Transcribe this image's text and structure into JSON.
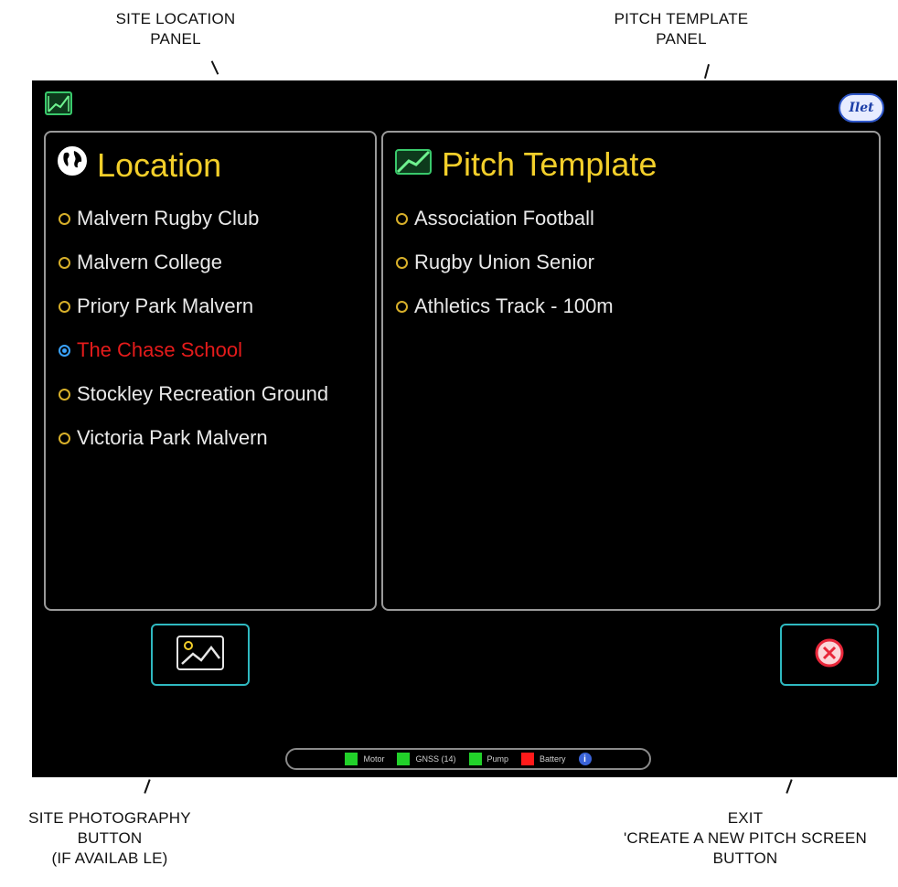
{
  "callouts": {
    "site_location": [
      "SITE LOCATION",
      "PANEL"
    ],
    "pitch_template": [
      "PITCH TEMPLATE",
      "PANEL"
    ],
    "site_photography": [
      "SITE PHOTOGRAPHY",
      "BUTTON",
      "(IF AVAILAB  LE)"
    ],
    "exit": [
      "EXIT",
      "'CREATE A NEW PITCH SCREEN",
      "BUTTON"
    ]
  },
  "header": {
    "left_icon": "pitch-map-icon",
    "brand_text": "Ilet"
  },
  "location_panel": {
    "title": "Location",
    "icon": "globe-icon",
    "items": [
      {
        "label": "Malvern Rugby Club",
        "selected": false
      },
      {
        "label": "Malvern College",
        "selected": false
      },
      {
        "label": "Priory Park Malvern",
        "selected": false
      },
      {
        "label": "The Chase School",
        "selected": true
      },
      {
        "label": "Stockley Recreation Ground",
        "selected": false
      },
      {
        "label": "Victoria Park Malvern",
        "selected": false
      }
    ]
  },
  "pitch_panel": {
    "title": "Pitch Template",
    "icon": "pitch-map-icon",
    "items": [
      {
        "label": "Association Football",
        "selected": false
      },
      {
        "label": "Rugby Union Senior",
        "selected": false
      },
      {
        "label": "Athletics Track - 100m",
        "selected": false
      }
    ]
  },
  "buttons": {
    "photo_icon": "photo-icon",
    "exit_icon": "close-circle-icon"
  },
  "status_bar": [
    {
      "label": "Motor",
      "color": "#22d12a"
    },
    {
      "label": "GNSS (14)",
      "color": "#22d12a"
    },
    {
      "label": "Pump",
      "color": "#22d12a"
    },
    {
      "label": "Battery",
      "color": "#ff1a1a"
    }
  ],
  "colors": {
    "title": "#f3cf2a",
    "selected_text": "#e51b1b",
    "button_border": "#2fb9c0",
    "exit_icon": "#e8273a"
  }
}
